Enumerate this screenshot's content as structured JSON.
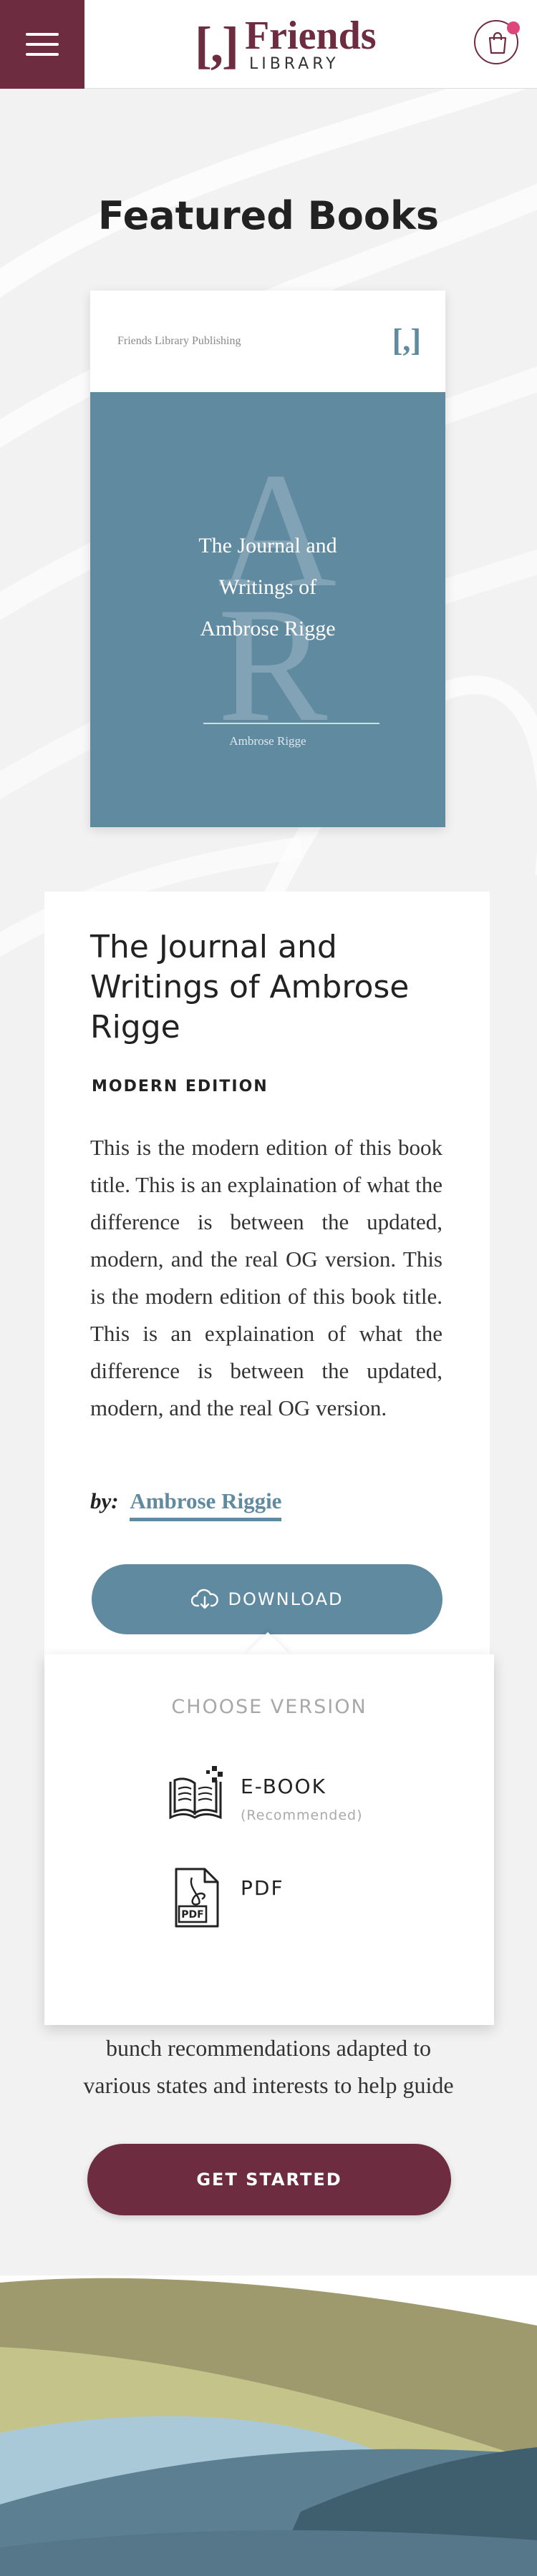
{
  "header": {
    "logo_mark": "[,]",
    "logo_name": "Friends",
    "logo_sub": "LIBRARY"
  },
  "featured": {
    "title": "Featured Books"
  },
  "cover": {
    "publisher": "Friends Library Publishing",
    "mark": "[,]",
    "letter_1": "A",
    "letter_2": "R",
    "title_line_1": "The Journal and",
    "title_line_2": "Writings of",
    "title_line_3": "Ambrose Rigge",
    "author": "Ambrose Rigge",
    "color": "#5f8aa0"
  },
  "book": {
    "title": "The Journal and Writings of Ambrose Rigge",
    "edition": "MODERN EDITION",
    "description": "This is the modern edition of this book title. This is an explaination of what the difference is between the updated, modern, and the real OG version. This is the modern edition of this book title. This is an explaination of what the difference is between the updated, modern, and the real OG version.",
    "by_label": "by:",
    "author": "Ambrose Riggie",
    "download_label": "DOWNLOAD"
  },
  "dropdown": {
    "choose_label": "CHOOSE VERSION",
    "options": [
      {
        "label": "E-BOOK",
        "note": "(Recommended)",
        "icon": "ebook-icon"
      },
      {
        "label": "PDF",
        "icon": "pdf-icon",
        "icon_text": "PDF"
      }
    ]
  },
  "cta": {
    "line_1": "bunch recommendations adapted to",
    "line_2": "various states and interests to help guide",
    "button_label": "GET STARTED"
  },
  "colors": {
    "brand": "#6e2c40",
    "accent": "#5f8aa0",
    "cart_dot": "#e0457a"
  }
}
